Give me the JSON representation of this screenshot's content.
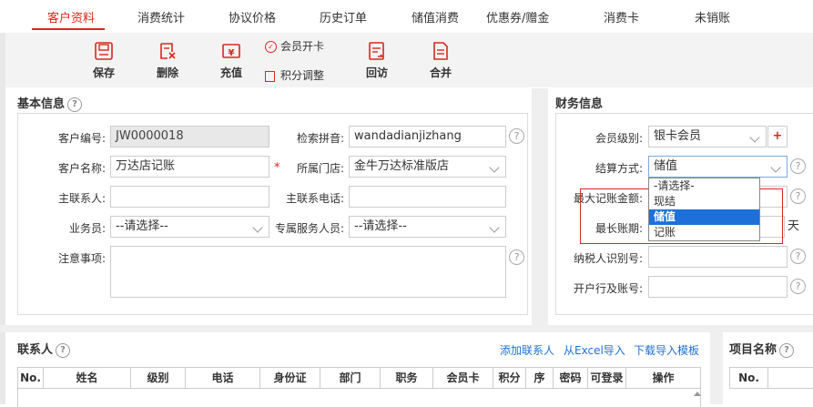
{
  "tabs": [
    "客户资料",
    "消费统计",
    "协议价格",
    "历史订单",
    "储值消费",
    "优惠券/赠金",
    "消费卡",
    "未销账"
  ],
  "active_tab": "客户资料",
  "toolbar": {
    "save": "保存",
    "delete": "删除",
    "recharge": "充值",
    "open_card": "会员开卡",
    "points_adjust": "积分调整",
    "revisit": "回访",
    "merge": "合并"
  },
  "basic": {
    "title": "基本信息",
    "customer_no_label": "客户编号:",
    "customer_no": "JW0000018",
    "pinyin_label": "检索拼音:",
    "pinyin": "wandadianjizhang",
    "name_label": "客户名称:",
    "name": "万达店记账",
    "store_label": "所属门店:",
    "store": "金牛万达标准版店",
    "contact_label": "主联系人:",
    "contact": "",
    "phone_label": "主联系电话:",
    "phone": "",
    "salesman_label": "业务员:",
    "salesman": "--请选择--",
    "service_label": "专属服务人员:",
    "service": "--请选择--",
    "notes_label": "注意事项:",
    "notes": ""
  },
  "finance": {
    "title": "财务信息",
    "level_label": "会员级别:",
    "level": "银卡会员",
    "plus": "+",
    "settle_label": "结算方式:",
    "settle": "储值",
    "max_amount_label": "最大记账金额:",
    "max_days_label": "最长账期:",
    "days_unit": "天",
    "tax_label": "纳税人识别号:",
    "bank_label": "开户行及账号:",
    "options": [
      "-请选择-",
      "现结",
      "储值",
      "记账"
    ],
    "selected_option": "储值"
  },
  "contacts": {
    "title": "联系人",
    "add": "添加联系人",
    "import_excel": "从Excel导入",
    "download_template": "下载导入模板",
    "columns": [
      "No.",
      "姓名",
      "级别",
      "电话",
      "身份证",
      "部门",
      "职务",
      "会员卡",
      "积分",
      "序",
      "密码",
      "可登录",
      "操作"
    ]
  },
  "projects": {
    "title": "项目名称",
    "columns": [
      "No."
    ]
  },
  "help_glyph": "?",
  "colors": {
    "accent_red": "#d9281c",
    "link_blue": "#1e6fd9",
    "select_blue": "#1e6fd9"
  }
}
